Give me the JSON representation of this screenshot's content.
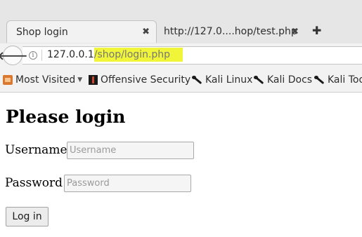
{
  "browser": {
    "tabs": [
      {
        "label": "Shop login",
        "active": true,
        "close": "✖"
      },
      {
        "label": "http://127.0....hop/test.php",
        "active": false,
        "close": "✖"
      }
    ],
    "new_tab": "✚",
    "url": {
      "host": "127.0.0.1",
      "path": "/shop/login.php",
      "highlight_color": "#f1f53a"
    },
    "bookmarks": [
      {
        "label": "Most Visited",
        "icon": "folder-icon",
        "caret": "▼"
      },
      {
        "label": "Offensive Security",
        "icon": "offsec-icon"
      },
      {
        "label": "Kali Linux",
        "icon": "kali-dragon-icon"
      },
      {
        "label": "Kali Docs",
        "icon": "kali-dragon-icon"
      },
      {
        "label": "Kali Tools",
        "icon": "kali-dragon-icon"
      }
    ]
  },
  "page": {
    "heading": "Please login",
    "username": {
      "label": "Username",
      "placeholder": "Username",
      "value": ""
    },
    "password": {
      "label": "Password",
      "placeholder": "Password",
      "value": ""
    },
    "submit_label": "Log in"
  }
}
